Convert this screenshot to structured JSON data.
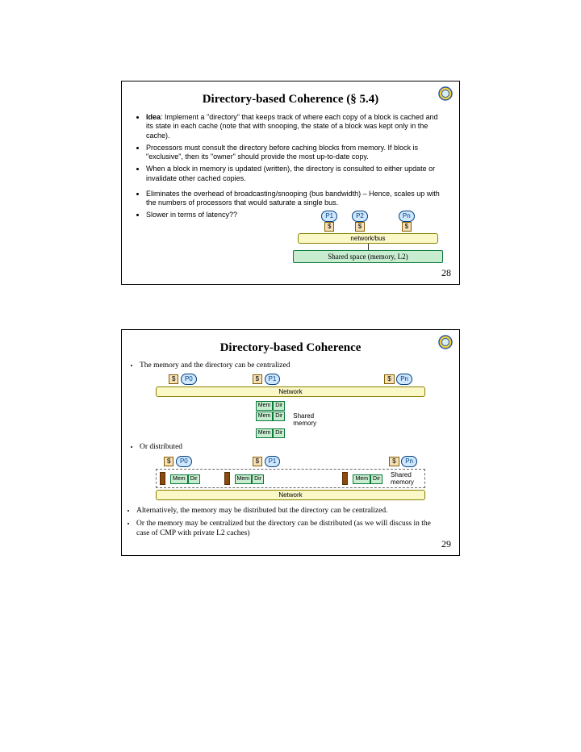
{
  "slide1": {
    "title": "Directory-based Coherence (§ 5.4)",
    "b1_prefix": "Idea",
    "b1": ": Implement a \"directory\" that keeps track of where each copy of a block is cached and its state in each cache (note that with snooping, the state of a block was kept only in the cache).",
    "b2": "Processors must consult the directory before caching blocks from memory. If block is \"exclusive\", then its \"owner\" should provide the most up-to-date copy.",
    "b3": "When a block in memory is updated (written), the directory is consulted to either update or invalidate other cached copies.",
    "b4": "Eliminates the overhead of broadcasting/snooping (bus bandwidth) – Hence, scales up with the numbers of processors that would saturate a single bus.",
    "b5": "Slower in terms of latency??",
    "p1": "P1",
    "p2": "P2",
    "pn": "Pn",
    "cache": "$",
    "bus": "network/bus",
    "shared": "Shared space (memory, L2)",
    "page": "28"
  },
  "slide2": {
    "title": "Directory-based Coherence",
    "b1": "The memory and the directory can be centralized",
    "b2": "Or distributed",
    "b3": "Alternatively, the memory may be distributed but the directory can be centralized.",
    "b4": "Or the memory may be centralized but the directory can be distributed (as we will discuss in the case of CMP with private L2 caches)",
    "cache": "$",
    "p0": "P0",
    "p1": "P1",
    "pn": "Pn",
    "network": "Network",
    "mem": "Mem",
    "dir": "Dir",
    "shared": "Shared memory",
    "page": "29"
  }
}
